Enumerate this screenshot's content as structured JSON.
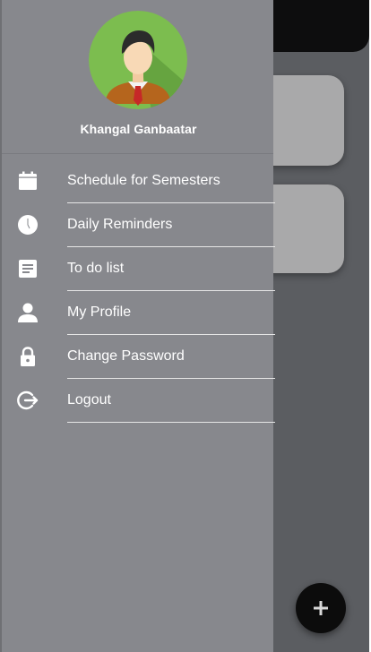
{
  "drawer": {
    "user_name": "Khangal Ganbaatar",
    "menu": [
      {
        "label": "Schedule for Semesters",
        "icon": "calendar-icon"
      },
      {
        "label": "Daily Reminders",
        "icon": "clock-icon"
      },
      {
        "label": "To do list",
        "icon": "note-icon"
      },
      {
        "label": "My Profile",
        "icon": "person-icon"
      },
      {
        "label": "Change Password",
        "icon": "lock-icon"
      },
      {
        "label": "Logout",
        "icon": "logout-icon"
      }
    ]
  },
  "fab": {
    "icon": "plus-icon"
  },
  "colors": {
    "drawer_bg": "#87888d",
    "overlay_bg": "#5b5d61",
    "topbar": "#0d0d0e",
    "card": "#a9a9aa",
    "fab": "#0c0c0c",
    "divider": "#e6e6e6",
    "text": "#ffffff"
  }
}
